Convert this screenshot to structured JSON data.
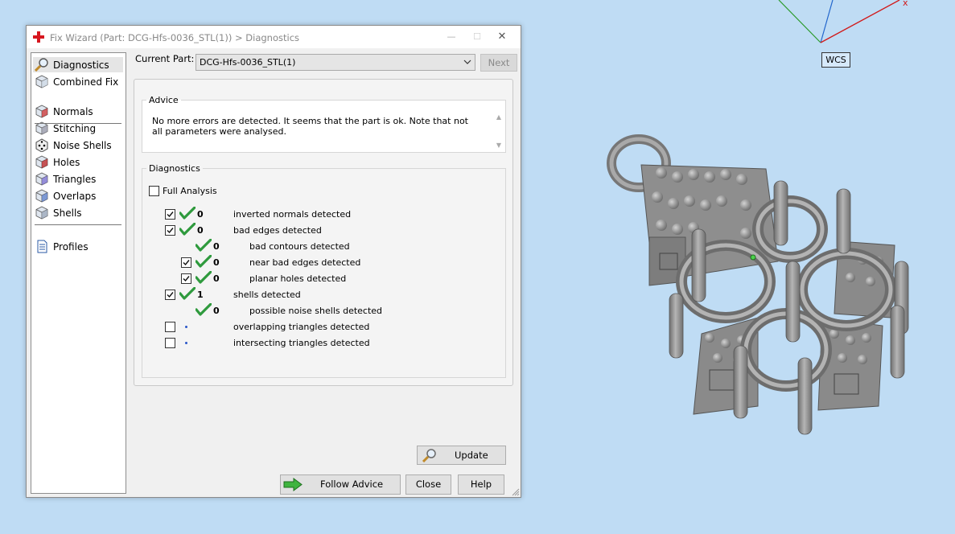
{
  "viewport": {
    "wcs_label": "WCS",
    "axis_x_label": "x",
    "colors": {
      "background": "#bfdcf4",
      "axis_x": "#d11a1a",
      "axis_y": "#2a9a2a",
      "axis_z": "#2266cc",
      "model": "#8d8d8d"
    }
  },
  "window": {
    "title": "Fix Wizard (Part: DCG-Hfs-0036_STL(1)) > Diagnostics",
    "title_controls": {
      "minimize": "—",
      "maximize": "☐",
      "close": "✕"
    }
  },
  "nav": {
    "groups": [
      {
        "items": [
          {
            "id": "diagnostics",
            "label": "Diagnostics",
            "icon": "magnifier-icon",
            "selected": true
          },
          {
            "id": "combined-fix",
            "label": "Combined Fix",
            "icon": "cube-icon",
            "selected": false
          }
        ]
      },
      {
        "items": [
          {
            "id": "normals",
            "label": "Normals",
            "icon": "cube-normals-icon"
          },
          {
            "id": "stitching",
            "label": "Stitching",
            "icon": "cube-stitch-icon"
          },
          {
            "id": "noise-shells",
            "label": "Noise Shells",
            "icon": "dice-icon"
          },
          {
            "id": "holes",
            "label": "Holes",
            "icon": "cube-holes-icon"
          },
          {
            "id": "triangles",
            "label": "Triangles",
            "icon": "cube-triangles-icon"
          },
          {
            "id": "overlaps",
            "label": "Overlaps",
            "icon": "cube-overlaps-icon"
          },
          {
            "id": "shells",
            "label": "Shells",
            "icon": "cube-shells-icon"
          }
        ]
      },
      {
        "items": [
          {
            "id": "profiles",
            "label": "Profiles",
            "icon": "document-icon"
          }
        ]
      }
    ]
  },
  "current_part": {
    "label": "Current Part:",
    "value": "DCG-Hfs-0036_STL(1)",
    "next_label": "Next"
  },
  "advice": {
    "legend": "Advice",
    "text": "No more errors are detected. It seems that the part is ok. Note that not all parameters were analysed."
  },
  "diagnostics": {
    "legend": "Diagnostics",
    "full_analysis_label": "Full Analysis",
    "full_analysis_checked": false,
    "rows": [
      {
        "level": 0,
        "checkbox": true,
        "checked": true,
        "status": "ok",
        "count": "0",
        "label": "inverted normals detected"
      },
      {
        "level": 0,
        "checkbox": true,
        "checked": true,
        "status": "ok",
        "count": "0",
        "label": "bad edges detected"
      },
      {
        "level": 1,
        "checkbox": false,
        "checked": false,
        "status": "ok",
        "count": "0",
        "label": "bad contours detected"
      },
      {
        "level": 1,
        "checkbox": true,
        "checked": true,
        "status": "ok",
        "count": "0",
        "label": "near bad edges detected"
      },
      {
        "level": 1,
        "checkbox": true,
        "checked": true,
        "status": "ok",
        "count": "0",
        "label": "planar holes detected"
      },
      {
        "level": 0,
        "checkbox": true,
        "checked": true,
        "status": "ok",
        "count": "1",
        "label": "shells detected"
      },
      {
        "level": 1,
        "checkbox": false,
        "checked": false,
        "status": "ok",
        "count": "0",
        "label": "possible noise shells detected"
      },
      {
        "level": 0,
        "checkbox": true,
        "checked": false,
        "status": "none",
        "count": "",
        "label": "overlapping triangles detected"
      },
      {
        "level": 0,
        "checkbox": true,
        "checked": false,
        "status": "none",
        "count": "",
        "label": "intersecting triangles detected"
      }
    ],
    "update_label": "Update"
  },
  "buttons": {
    "follow_advice": "Follow Advice",
    "close": "Close",
    "help": "Help"
  }
}
